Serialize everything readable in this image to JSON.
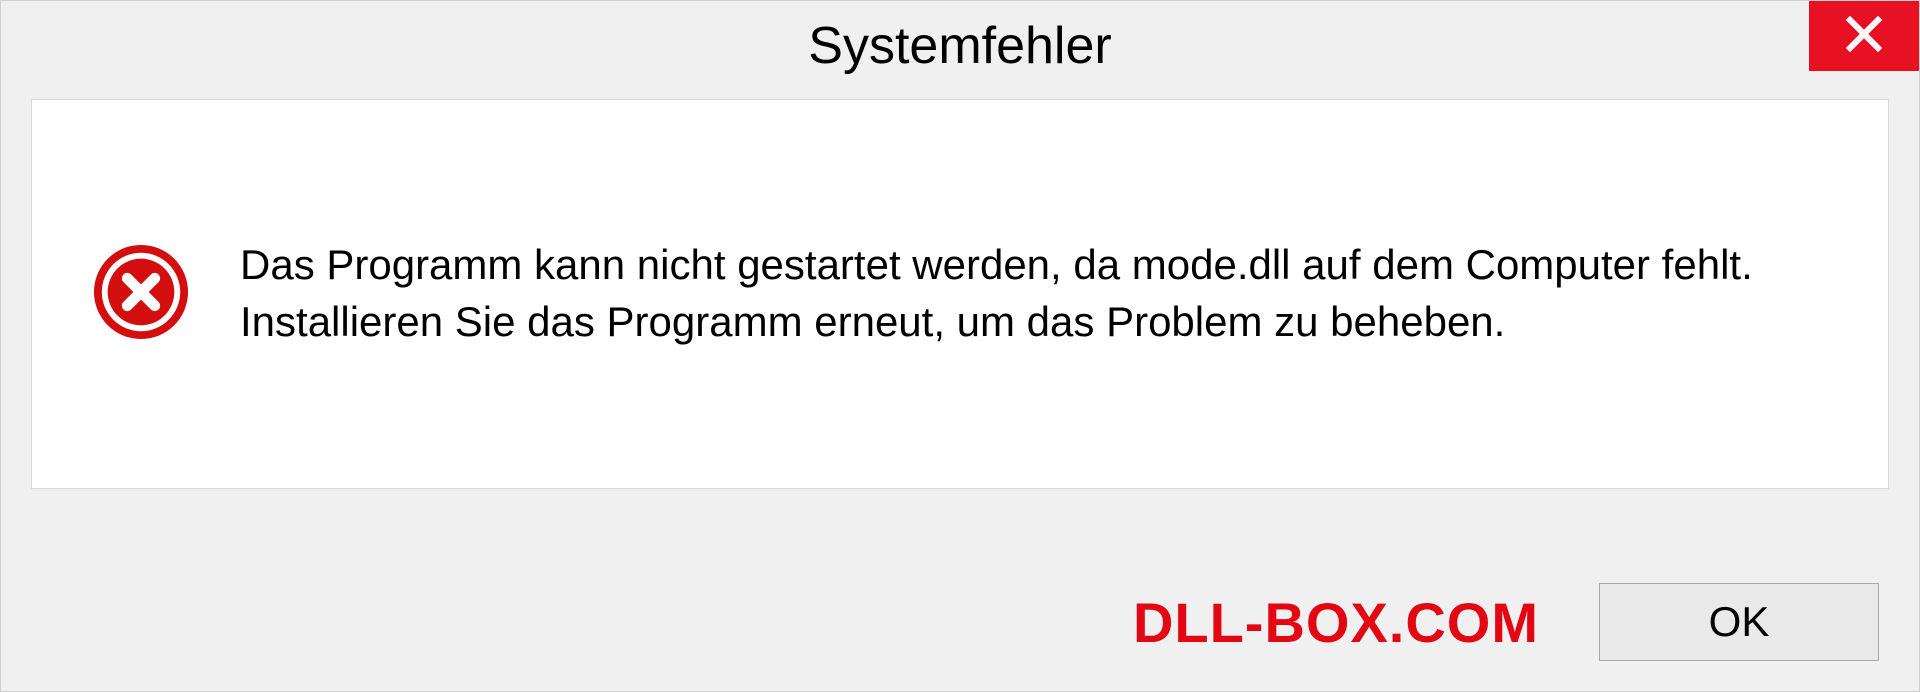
{
  "dialog": {
    "title": "Systemfehler",
    "message": "Das Programm kann nicht gestartet werden, da mode.dll auf dem Computer fehlt. Installieren Sie das Programm erneut, um das Problem zu beheben.",
    "ok_label": "OK"
  },
  "watermark": "DLL-BOX.COM",
  "colors": {
    "close_bg": "#e81123",
    "watermark": "#e30613"
  }
}
